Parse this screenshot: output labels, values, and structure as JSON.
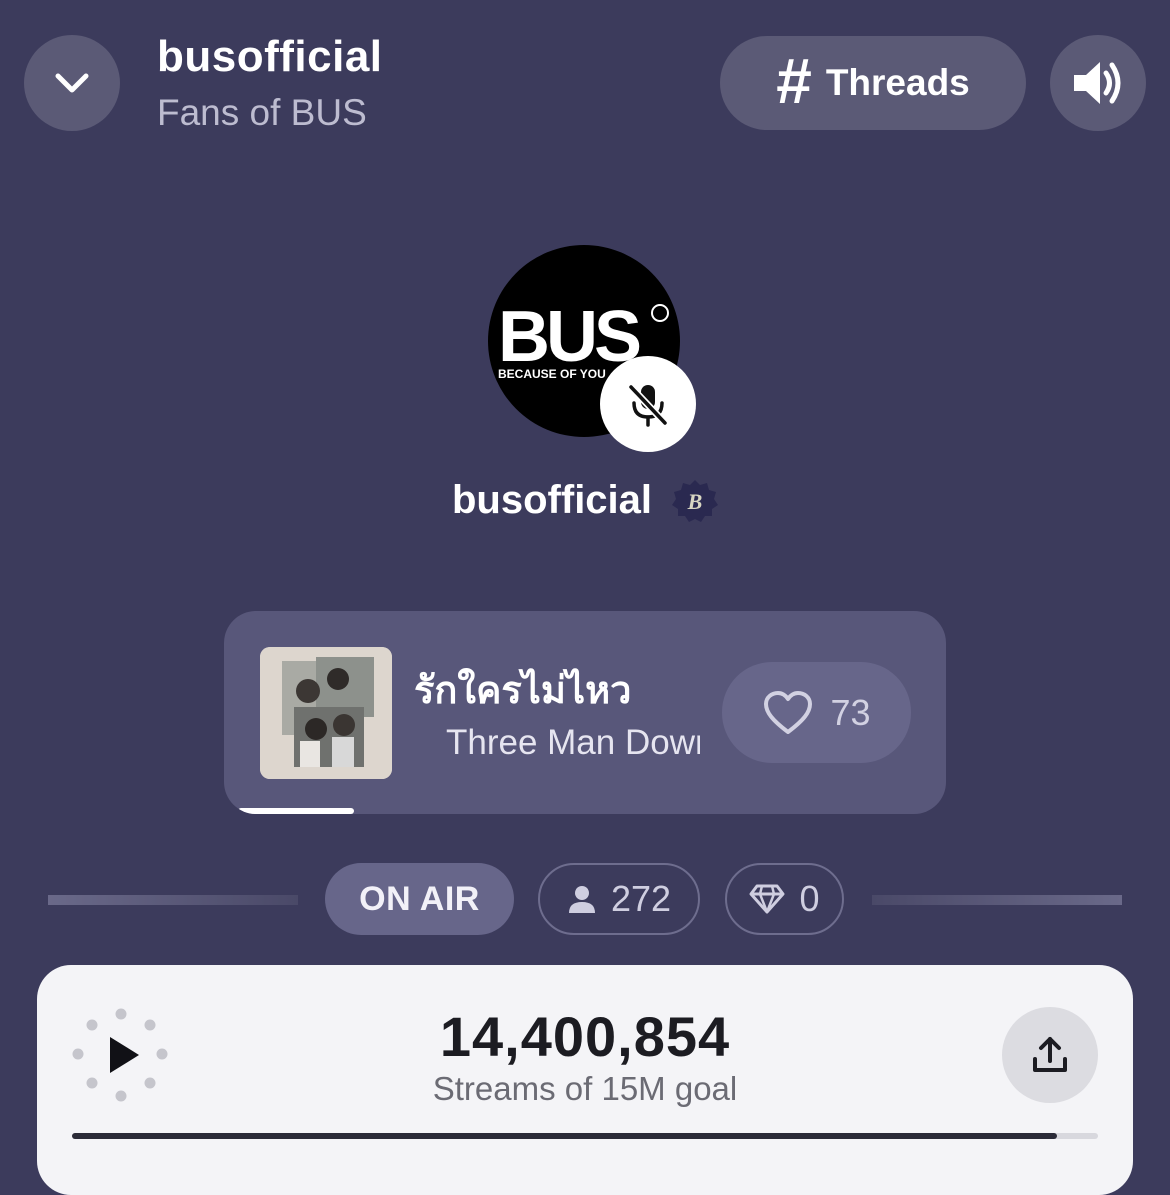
{
  "header": {
    "title": "busofficial",
    "subtitle": "Fans of BUS",
    "threads_label": "Threads"
  },
  "host": {
    "name": "busofficial",
    "logo_text": "BUS",
    "logo_tagline": "BECAUSE OF YOU",
    "badge_letter": "B"
  },
  "now_playing": {
    "title": "รักใครไม่ไหว",
    "artist": "Three Man Down",
    "likes": "73",
    "progress": 0.16
  },
  "status": {
    "on_air_label": "ON AIR",
    "listeners": "272",
    "gems": "0"
  },
  "streams": {
    "count": "14,400,854",
    "goal_label": "Streams of 15M goal",
    "progress": 0.96
  },
  "colors": {
    "background": "#3c3b5c",
    "pill": "#5b5a76",
    "card": "#f4f4f7"
  }
}
